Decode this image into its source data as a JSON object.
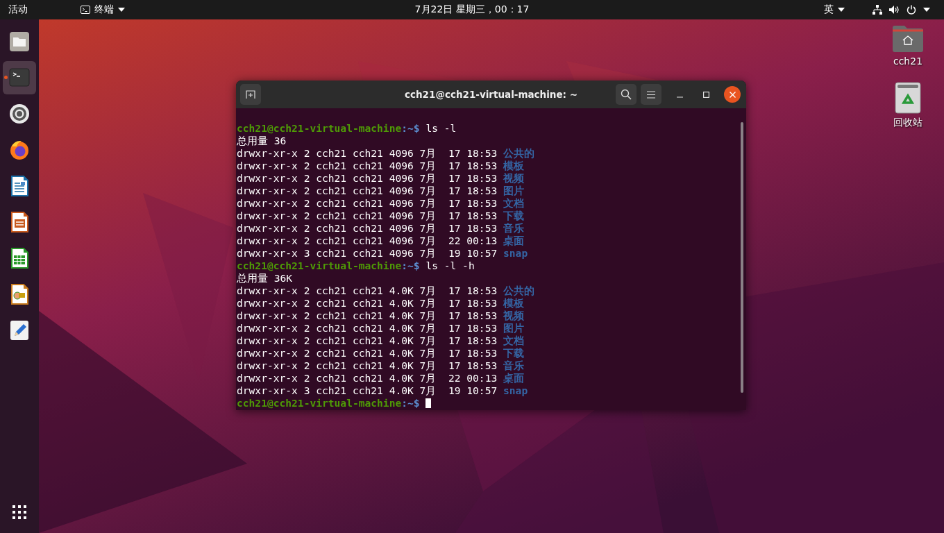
{
  "top_bar": {
    "activities": "活动",
    "app_menu": {
      "label": "终端"
    },
    "clock": "7月22日 星期三，00：17",
    "input_method": "英"
  },
  "dock": {
    "items": [
      {
        "kind": "files",
        "selected": false,
        "running": false
      },
      {
        "kind": "terminal",
        "selected": true,
        "running": true
      },
      {
        "kind": "settings",
        "selected": false,
        "running": false
      },
      {
        "kind": "browser",
        "selected": false,
        "running": false
      },
      {
        "kind": "document",
        "selected": false,
        "running": false
      },
      {
        "kind": "presentation",
        "selected": false,
        "running": false
      },
      {
        "kind": "spreadsheet",
        "selected": false,
        "running": false
      },
      {
        "kind": "drawing",
        "selected": false,
        "running": false
      },
      {
        "kind": "editor",
        "selected": false,
        "running": false
      }
    ]
  },
  "desktop_icons": [
    {
      "kind": "home",
      "label": "cch21"
    },
    {
      "kind": "trash",
      "label": "回收站"
    }
  ],
  "window": {
    "title": "cch21@cch21-virtual-machine: ~",
    "lines": [
      {
        "kind": "prompt",
        "user": "cch21@cch21-virtual-machine",
        "path": ":~$",
        "command": "ls -l",
        "cursor": false
      },
      {
        "kind": "output",
        "text": "总用量 36"
      },
      {
        "kind": "entry",
        "info": "drwxr-xr-x 2 cch21 cch21 4096 7月  17 18:53",
        "name": "公共的"
      },
      {
        "kind": "entry",
        "info": "drwxr-xr-x 2 cch21 cch21 4096 7月  17 18:53",
        "name": "模板"
      },
      {
        "kind": "entry",
        "info": "drwxr-xr-x 2 cch21 cch21 4096 7月  17 18:53",
        "name": "视频"
      },
      {
        "kind": "entry",
        "info": "drwxr-xr-x 2 cch21 cch21 4096 7月  17 18:53",
        "name": "图片"
      },
      {
        "kind": "entry",
        "info": "drwxr-xr-x 2 cch21 cch21 4096 7月  17 18:53",
        "name": "文档"
      },
      {
        "kind": "entry",
        "info": "drwxr-xr-x 2 cch21 cch21 4096 7月  17 18:53",
        "name": "下载"
      },
      {
        "kind": "entry",
        "info": "drwxr-xr-x 2 cch21 cch21 4096 7月  17 18:53",
        "name": "音乐"
      },
      {
        "kind": "entry",
        "info": "drwxr-xr-x 2 cch21 cch21 4096 7月  22 00:13",
        "name": "桌面"
      },
      {
        "kind": "entry",
        "info": "drwxr-xr-x 3 cch21 cch21 4096 7月  19 10:57",
        "name": "snap"
      },
      {
        "kind": "prompt",
        "user": "cch21@cch21-virtual-machine",
        "path": ":~$",
        "command": "ls -l -h",
        "cursor": false
      },
      {
        "kind": "output",
        "text": "总用量 36K"
      },
      {
        "kind": "entry",
        "info": "drwxr-xr-x 2 cch21 cch21 4.0K 7月  17 18:53",
        "name": "公共的"
      },
      {
        "kind": "entry",
        "info": "drwxr-xr-x 2 cch21 cch21 4.0K 7月  17 18:53",
        "name": "模板"
      },
      {
        "kind": "entry",
        "info": "drwxr-xr-x 2 cch21 cch21 4.0K 7月  17 18:53",
        "name": "视频"
      },
      {
        "kind": "entry",
        "info": "drwxr-xr-x 2 cch21 cch21 4.0K 7月  17 18:53",
        "name": "图片"
      },
      {
        "kind": "entry",
        "info": "drwxr-xr-x 2 cch21 cch21 4.0K 7月  17 18:53",
        "name": "文档"
      },
      {
        "kind": "entry",
        "info": "drwxr-xr-x 2 cch21 cch21 4.0K 7月  17 18:53",
        "name": "下载"
      },
      {
        "kind": "entry",
        "info": "drwxr-xr-x 2 cch21 cch21 4.0K 7月  17 18:53",
        "name": "音乐"
      },
      {
        "kind": "entry",
        "info": "drwxr-xr-x 2 cch21 cch21 4.0K 7月  22 00:13",
        "name": "桌面"
      },
      {
        "kind": "entry",
        "info": "drwxr-xr-x 3 cch21 cch21 4.0K 7月  19 10:57",
        "name": "snap"
      },
      {
        "kind": "prompt",
        "user": "cch21@cch21-virtual-machine",
        "path": ":~$",
        "cursor": true
      }
    ]
  }
}
